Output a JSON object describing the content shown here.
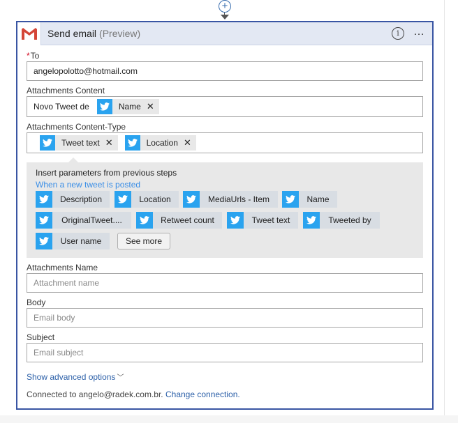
{
  "connector": {
    "plus_symbol": "+"
  },
  "card": {
    "title": "Send email",
    "preview": "(Preview)",
    "info_icon": "i",
    "more_icon": "…"
  },
  "to": {
    "required_mark": "*",
    "label": "To",
    "value": "angelopolotto@hotmail.com"
  },
  "attachments_content": {
    "label": "Attachments Content",
    "prefix_text": "Novo Tweet de",
    "tokens": [
      {
        "label": "Name",
        "icon": "twitter-icon"
      }
    ]
  },
  "attachments_content_type": {
    "label": "Attachments Content-Type",
    "tokens": [
      {
        "label": "Tweet text",
        "icon": "twitter-icon"
      },
      {
        "label": "Location",
        "icon": "twitter-icon"
      }
    ]
  },
  "params_panel": {
    "title": "Insert parameters from previous steps",
    "source": "When a new tweet is posted",
    "chips": [
      {
        "label": "Description"
      },
      {
        "label": "Location"
      },
      {
        "label": "MediaUrls - Item"
      },
      {
        "label": "Name"
      },
      {
        "label": "OriginalTweet...."
      },
      {
        "label": "Retweet count"
      },
      {
        "label": "Tweet text"
      },
      {
        "label": "Tweeted by"
      },
      {
        "label": "User name"
      }
    ],
    "see_more": "See more"
  },
  "attachments_name": {
    "label": "Attachments Name",
    "placeholder": "Attachment name"
  },
  "body": {
    "label": "Body",
    "placeholder": "Email body"
  },
  "subject": {
    "label": "Subject",
    "placeholder": "Email subject"
  },
  "advanced": {
    "label": "Show advanced options"
  },
  "connection": {
    "text": "Connected to angelo@radek.com.br.",
    "link": "Change connection."
  },
  "colors": {
    "card_border": "#3955a3",
    "header_bg": "#e3e8f3",
    "twitter_blue": "#2aa3ef",
    "link_blue": "#3a8ee6",
    "required_red": "#d0021b",
    "gmail_red": "#d44638"
  }
}
